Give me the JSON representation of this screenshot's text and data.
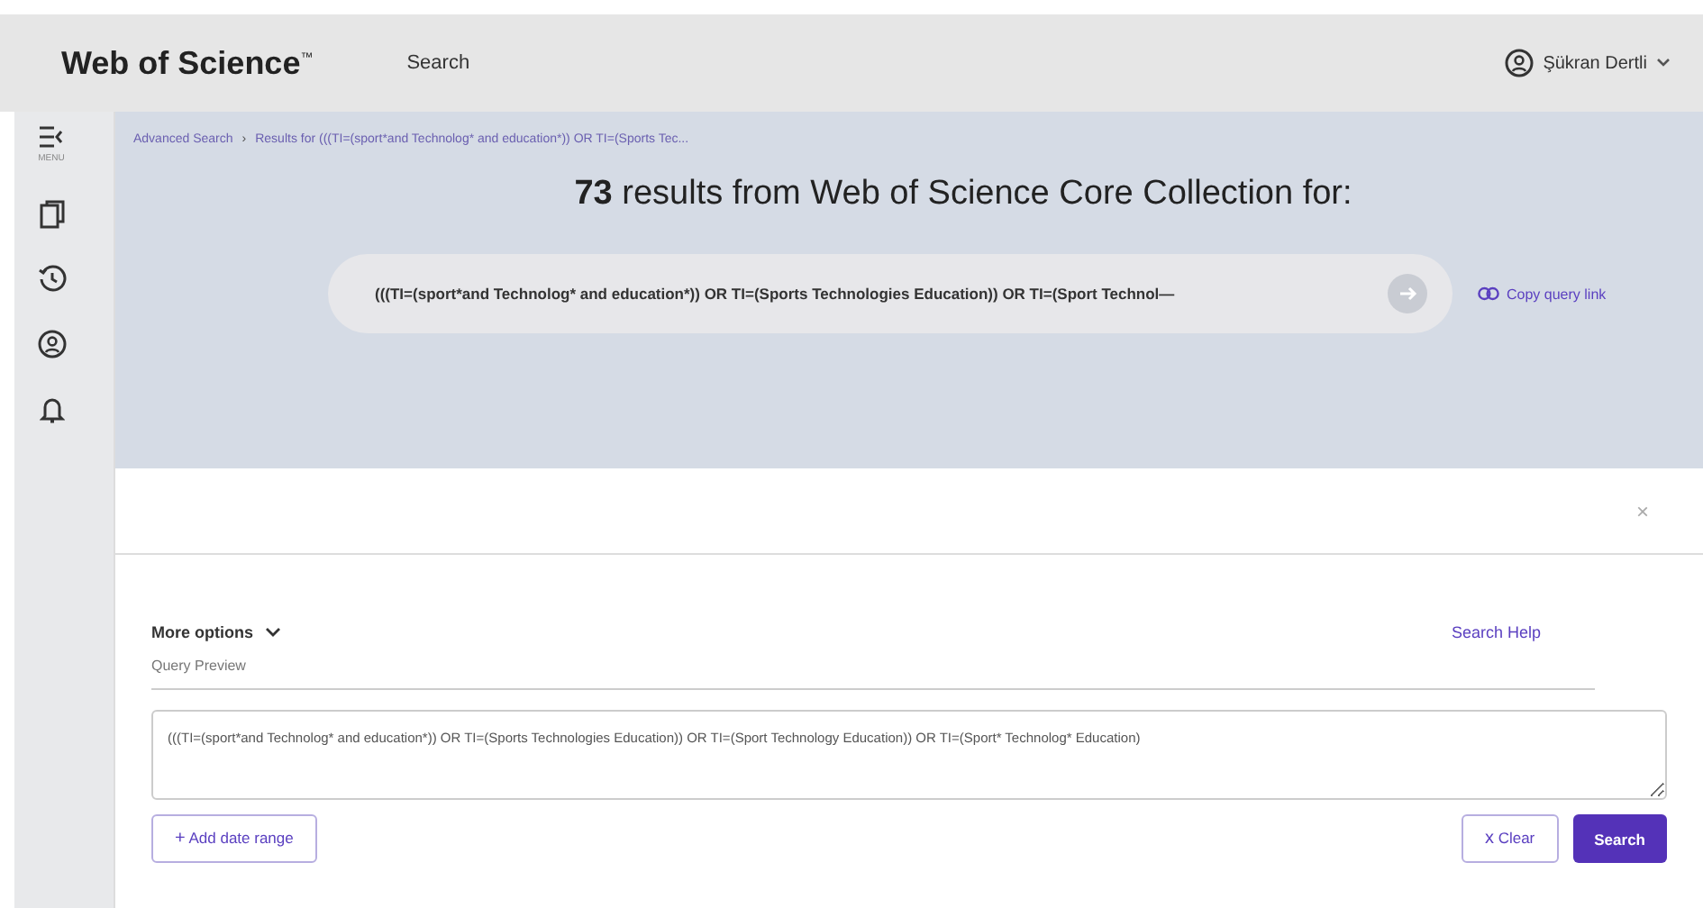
{
  "header": {
    "logo": "Web of Science",
    "logo_mark": "™",
    "nav": "Search",
    "user": "Şükran Dertli"
  },
  "sidebar": {
    "menu_label": "MENU",
    "items": [
      {
        "kind": "documents"
      },
      {
        "kind": "history"
      },
      {
        "kind": "profile"
      },
      {
        "kind": "alerts"
      }
    ]
  },
  "breadcrumb": [
    {
      "label": "Advanced Search",
      "separator": "›"
    },
    {
      "label": "Results for (((TI=(sport*and Technolog* and education*)) OR TI=(Sports Tec..."
    }
  ],
  "results": {
    "count": "73",
    "text": "results from Web of Science Core Collection for:",
    "query": "(((TI=(sport*and Technolog* and education*)) OR TI=(Sports Technologies Education)) OR TI=(Sport Technol—",
    "copy_link": "Copy query link"
  },
  "panel": {
    "close": "×",
    "more_options": "More options",
    "search_help": "Search Help",
    "preview_label": "Query Preview",
    "preview_value": "(((TI=(sport*and Technolog* and education*)) OR TI=(Sports Technologies Education)) OR TI=(Sport Technology Education)) OR TI=(Sport* Technolog* Education)",
    "add_date": "Add date range",
    "add_icon": "+",
    "clear": "Clear",
    "clear_icon": "x",
    "search": "Search"
  }
}
